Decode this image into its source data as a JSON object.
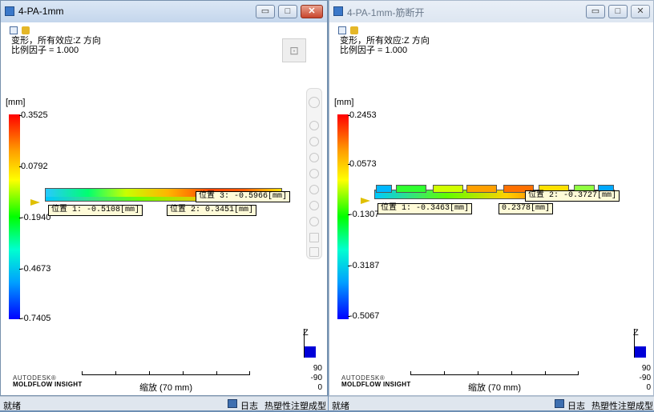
{
  "left": {
    "title": "4-PA-1mm",
    "info_line1": "变形，所有效应:Z 方向",
    "info_line2": "比例因子 = 1.000",
    "unit": "[mm]",
    "legend_ticks": [
      "0.3525",
      "0.0792",
      "-0.1940",
      "-0.4673",
      "-0.7405"
    ],
    "probes": [
      "位置 1: -0.5108[mm]",
      "位置 2: 0.3451[mm]",
      "位置 3: -0.5966[mm]"
    ],
    "axis_label": "Z",
    "triad_values": [
      "90",
      "-90",
      "0"
    ],
    "brand_line1": "AUTODESK®",
    "brand_line2": "MOLDFLOW INSIGHT",
    "scale_label": "缩放 (70 mm)",
    "status_text": "就绪",
    "log_label": "日志",
    "mode_label": "热塑性注塑成型"
  },
  "right": {
    "title": "4-PA-1mm-筋断开",
    "info_line1": "变形，所有效应:Z 方向",
    "info_line2": "比例因子 = 1.000",
    "unit": "[mm]",
    "legend_ticks": [
      "0.2453",
      "0.0573",
      "-0.1307",
      "-0.3187",
      "-0.5067"
    ],
    "probes": [
      "位置 1: -0.3463[mm]",
      "0.2378[mm]",
      "位置 2: -0.3727[mm]"
    ],
    "axis_label": "Z",
    "triad_values": [
      "90",
      "-90",
      "0"
    ],
    "brand_line1": "AUTODESK®",
    "brand_line2": "MOLDFLOW INSIGHT",
    "scale_label": "缩放 (70 mm)",
    "status_text": "就绪",
    "log_label": "日志",
    "mode_label": "热塑性注塑成型"
  },
  "window_buttons": {
    "minimize": "▭",
    "maximize": "□",
    "close": "✕"
  },
  "colors": {
    "legend_max": "#ff0000",
    "legend_min": "#0000ff",
    "probe_bg": "#fffbd8",
    "titlebar": "#c4d6ec"
  },
  "icons": [
    "app-icon",
    "result-icon",
    "folder-icon",
    "view-cube-icon",
    "rotate-icon",
    "select-icon",
    "pan-icon",
    "zoom-icon",
    "fit-icon",
    "measure-icon",
    "log-icon"
  ]
}
